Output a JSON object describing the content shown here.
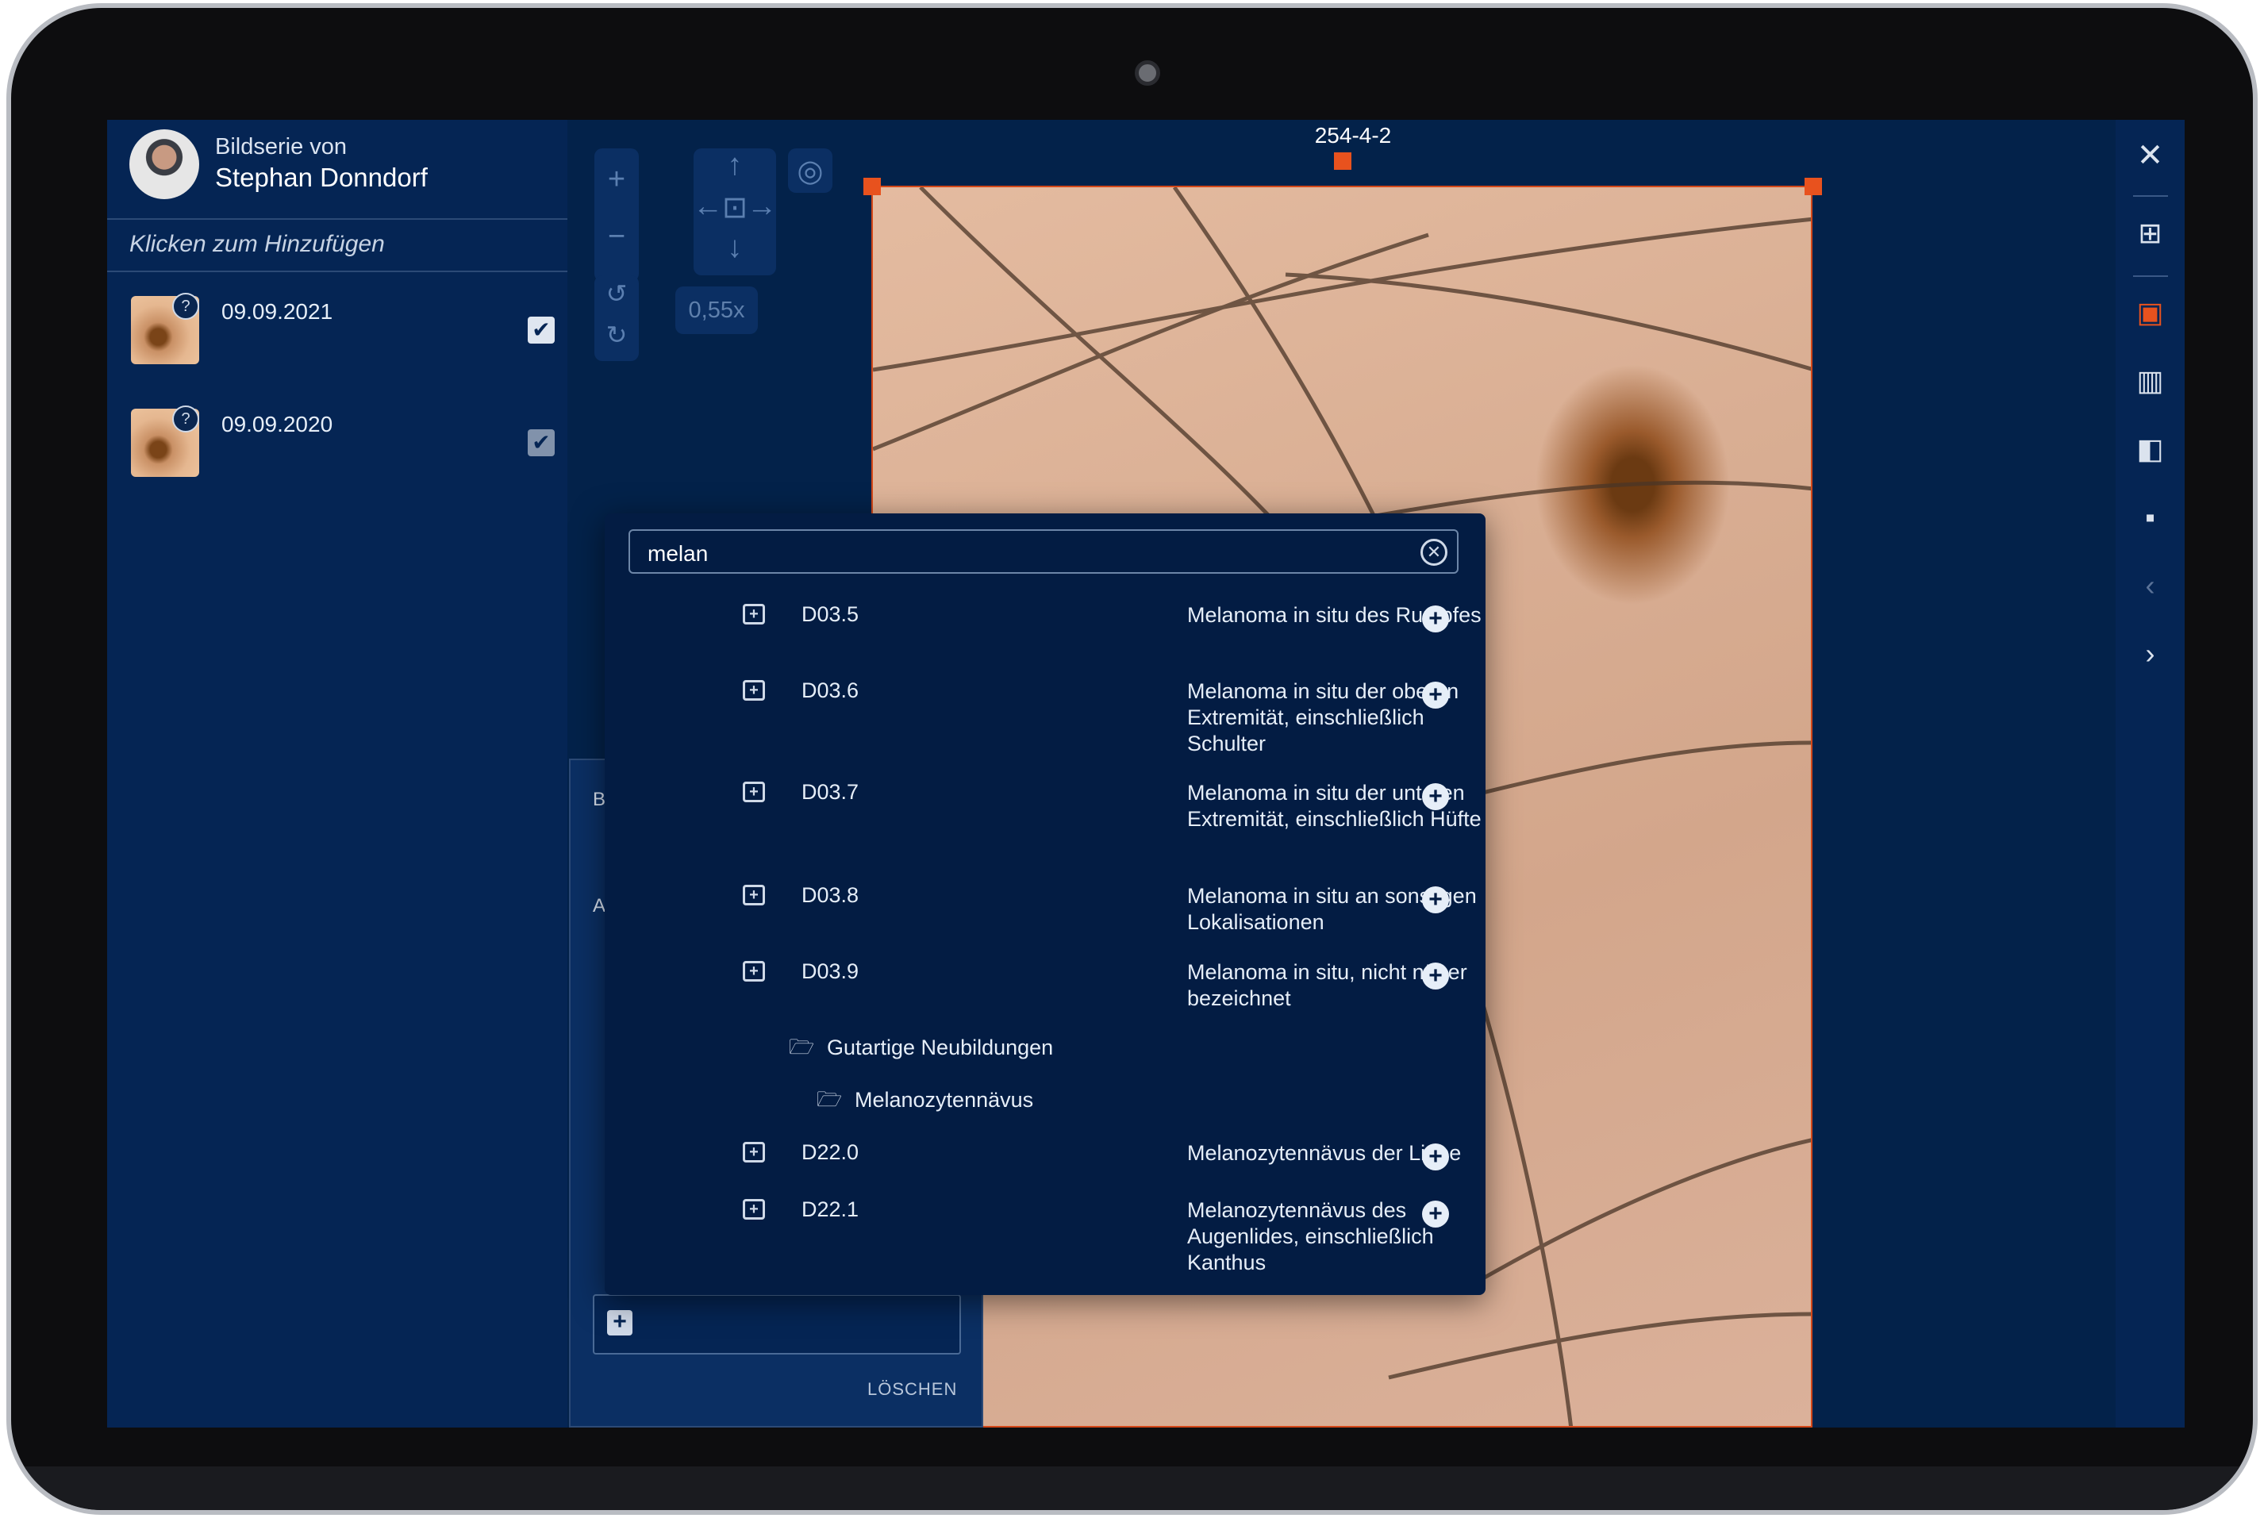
{
  "header": {
    "series_label": "Bildserie von",
    "series_name": "Stephan Donndorf"
  },
  "sidebar": {
    "add_hint": "Klicken zum Hinzufügen",
    "items": [
      {
        "date": "09.09.2021",
        "checked": true
      },
      {
        "date": "09.09.2020",
        "checked": true
      }
    ]
  },
  "toolbar": {
    "zoom": "0,55x"
  },
  "image": {
    "title": "254-4-2"
  },
  "search": {
    "value": "melan",
    "results": [
      {
        "code": "D03.5",
        "desc": "Melanoma in situ des Rumpfes"
      },
      {
        "code": "D03.6",
        "desc": "Melanoma in situ der oberen Extremität, einschließlich Schulter"
      },
      {
        "code": "D03.7",
        "desc": "Melanoma in situ der unteren Extremität, einschließlich Hüfte"
      },
      {
        "code": "D03.8",
        "desc": "Melanoma in situ an sonstigen Lokalisationen"
      },
      {
        "code": "D03.9",
        "desc": "Melanoma in situ, nicht näher bezeichnet"
      },
      {
        "folder": "Gutartige Neubildungen"
      },
      {
        "folder": "Melanozytennävus"
      },
      {
        "code": "D22.0",
        "desc": "Melanozytennävus der Lippe"
      },
      {
        "code": "D22.1",
        "desc": "Melanozytennävus des Augenlides, einschließlich Kanthus"
      }
    ]
  },
  "form": {
    "delete_label": "LÖSCHEN"
  },
  "colors": {
    "background": "#03224a",
    "accent": "#e8521e",
    "panel": "#052554"
  },
  "icons": {
    "close": "close-icon",
    "add_image": "add-image-icon",
    "image": "image-icon",
    "split": "split-view-icon",
    "compare": "compare-icon",
    "grid4": "grid-4-icon",
    "prev": "chevron-left-icon",
    "next": "chevron-right-icon"
  }
}
